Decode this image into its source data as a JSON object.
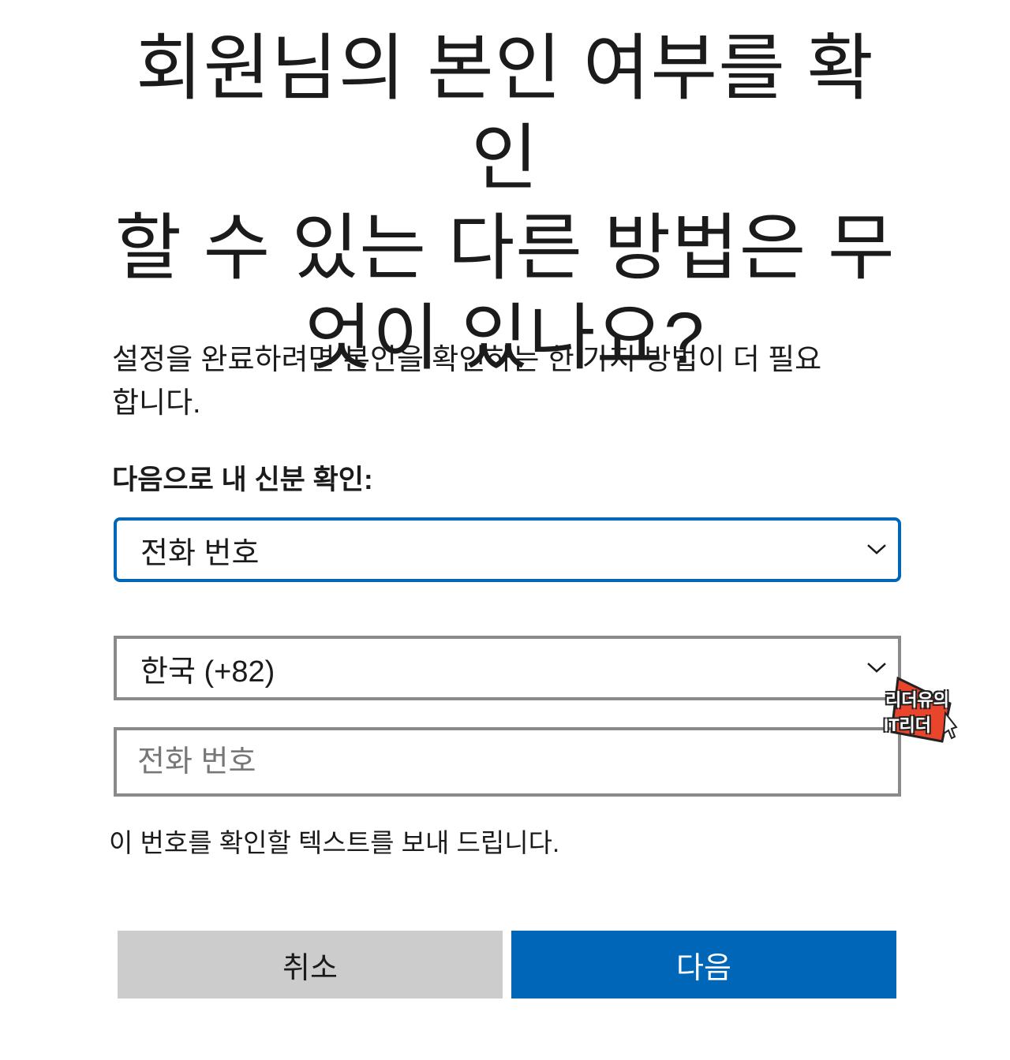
{
  "title_lines": [
    "회원님의 본인 여부를 확인",
    "할 수 있는 다른 방법은 무",
    "엇이 있나요?"
  ],
  "description_lines": [
    "설정을 완료하려면 본인을 확인하는 한 가지 방법이 더 필요",
    "합니다."
  ],
  "verify_label": "다음으로 내 신분 확인:",
  "method_select": {
    "value": "전화 번호"
  },
  "country_select": {
    "value": "한국 (+82)"
  },
  "phone_input": {
    "value": "",
    "placeholder": "전화 번호"
  },
  "hint": "이 번호를 확인할 텍스트를 보내 드립니다.",
  "buttons": {
    "cancel": "취소",
    "next": "다음"
  },
  "watermark": {
    "line1": "리더유의",
    "line2": "IT리더"
  },
  "colors": {
    "accent": "#0067b8",
    "cancel_bg": "#cccccc",
    "border": "#8a8a8a",
    "text": "#1b1b1b"
  }
}
